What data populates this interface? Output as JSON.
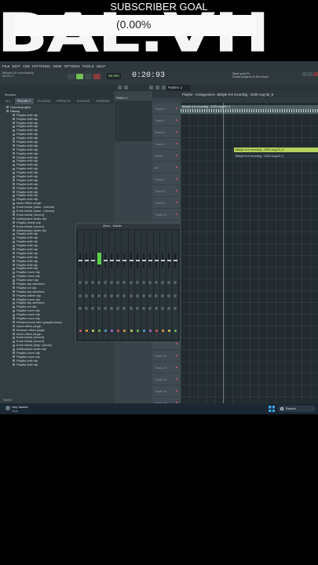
{
  "overlay": {
    "goal_title": "SUBSCRIBER GOAL",
    "goal_percent": "(0.00%",
    "goal_progress": 0.0,
    "big_text": "BAL.VH"
  },
  "menu": [
    "FILE",
    "EDIT",
    "ADD",
    "PATTERNS",
    "VIEW",
    "OPTIONS",
    "TOOLS",
    "HELP"
  ],
  "transport": {
    "tempo": "85.000",
    "timer": "0:20:93",
    "pattern": "Pattern 1",
    "record_title": "Bitbyte 6-8 recording.flp",
    "record_time": "46:09:17",
    "cloud_line1": "Save your FL",
    "cloud_line2": "Studio projects in the cloud"
  },
  "browser": {
    "header": "Browser",
    "tabs": [
      "ALL",
      "PROJECT",
      "PLUGINS",
      "PRESETS",
      "SOUNDS",
      "STARRED"
    ],
    "active_tab": "PROJECT",
    "tree": [
      {
        "label": "Current project",
        "folder": true
      },
      {
        "label": "History",
        "folder": true
      },
      {
        "label": "Playlist shift clip"
      },
      {
        "label": "Playlist shift clip"
      },
      {
        "label": "Playlist shift clip"
      },
      {
        "label": "Playlist shift clip"
      },
      {
        "label": "Playlist shift clip"
      },
      {
        "label": "Playlist shift clip"
      },
      {
        "label": "Playlist shift clip"
      },
      {
        "label": "Playlist shift clip"
      },
      {
        "label": "Playlist shift clip"
      },
      {
        "label": "Playlist shift clip"
      },
      {
        "label": "Playlist shift clip"
      },
      {
        "label": "Playlist shift clip"
      },
      {
        "label": "Playlist shift clip"
      },
      {
        "label": "Playlist shift clip"
      },
      {
        "label": "Playlist shift clip"
      },
      {
        "label": "Playlist shift clip"
      },
      {
        "label": "Playlist shift clip"
      },
      {
        "label": "Playlist shift clip"
      },
      {
        "label": "Playlist shift clip"
      },
      {
        "label": "Playlist shift clip"
      },
      {
        "label": "Playlist shift clip"
      },
      {
        "label": "Playlist shift clip"
      },
      {
        "label": "Playlist shift clip"
      },
      {
        "label": "Insert effect plugin"
      },
      {
        "label": "Knob tweak (bass - volume)"
      },
      {
        "label": "Knob tweak (bass - volume)"
      },
      {
        "label": "Knob tweak (record)"
      },
      {
        "label": "Add/replace audio clip"
      },
      {
        "label": "Playlist delete clip"
      },
      {
        "label": "Knob tweak (record)"
      },
      {
        "label": "Add/replace audio clip"
      },
      {
        "label": "Playlist shift clip"
      },
      {
        "label": "Playlist shift clip"
      },
      {
        "label": "Playlist shift clip"
      },
      {
        "label": "Playlist shift clip"
      },
      {
        "label": "Playlist shift clip"
      },
      {
        "label": "Playlist shift clip"
      },
      {
        "label": "Playlist shift clip"
      },
      {
        "label": "Playlist shift clip"
      },
      {
        "label": "Playlist shift clip"
      },
      {
        "label": "Playlist shift clip"
      },
      {
        "label": "Playlist move clip"
      },
      {
        "label": "Playlist move clip"
      },
      {
        "label": "Playlist slice clip"
      },
      {
        "label": "Playlist clip selection"
      },
      {
        "label": "Playlist cut clip"
      },
      {
        "label": "Playlist clip selection"
      },
      {
        "label": "Playlist delete clip"
      },
      {
        "label": "Playlist move clip"
      },
      {
        "label": "Playlist clip selection"
      },
      {
        "label": "Playlist cut clip"
      },
      {
        "label": "Playlist move clip"
      },
      {
        "label": "Playlist move clip"
      },
      {
        "label": "Playlist move clip"
      },
      {
        "label": "Rename/color item (playlist track)"
      },
      {
        "label": "Insert effect plugin"
      },
      {
        "label": "Browser effect plugin"
      },
      {
        "label": "Insert effect plugin"
      },
      {
        "label": "Knob tweak (record)"
      },
      {
        "label": "Knob tweak (record)"
      },
      {
        "label": "Knob tweak (play / pause)"
      },
      {
        "label": "Add/replace audio clip"
      },
      {
        "label": "Playlist move clip"
      },
      {
        "label": "Playlist move clip"
      },
      {
        "label": "Playlist shift clip"
      },
      {
        "label": "Playlist shift clip"
      }
    ],
    "footer": "TAGS"
  },
  "channel_rack": {
    "title": "Pattern 1"
  },
  "playlist": {
    "title": "Playlist - Arrangement › Bitbyte 6-8 recording - 2020-Aug-02_9",
    "tracks": [
      "Track 1",
      "Track 2",
      "Track 3",
      "Track 4",
      "Audio",
      "All",
      "Track 7",
      "Track 8",
      "Track 9",
      "Track 10",
      "",
      "",
      "",
      "",
      "",
      "",
      "",
      "",
      "",
      "",
      "",
      "Track 21",
      "Track 22",
      "Track 23",
      "Track 24",
      "Track 25",
      "Track 26"
    ],
    "audio_clip_label": "Bitbyte 6-8 recording - 2020-Aug-02_9",
    "green_clip_label": "Bitbyte 6-8 recording - 2020-Aug-02_9",
    "dark_clip_label": "Bitbyte 6-8 recording - 2020-Aug-02_9"
  },
  "mixer": {
    "title": "Mixer - Master",
    "strip_count": 16
  },
  "taskbar": {
    "user_name": "Hey Swerld",
    "user_status": "Now",
    "search_label": "Search"
  },
  "colors": {
    "accent_green": "#6fbf52",
    "clip_green": "#b5d25c",
    "record_red": "#d45b5b",
    "windows_blue": "#3ba7f0"
  }
}
